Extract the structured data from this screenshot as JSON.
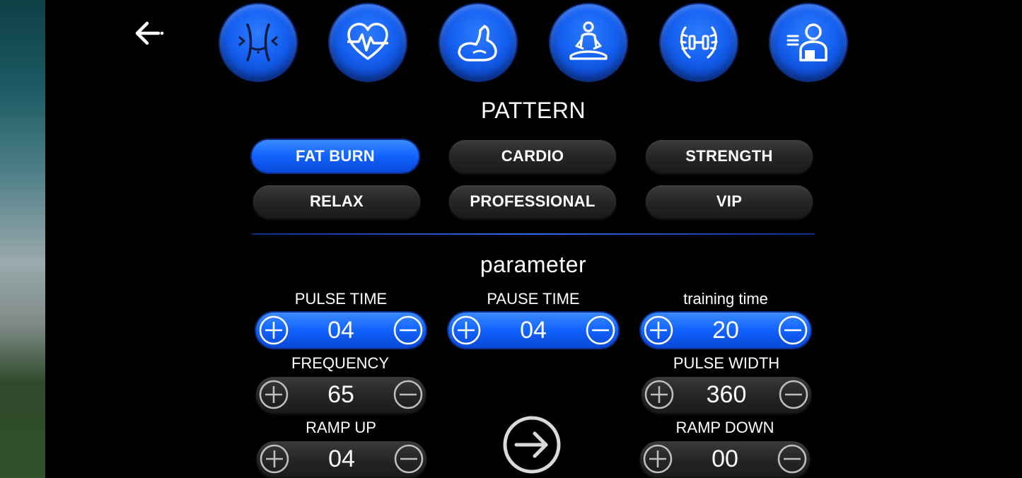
{
  "modes": [
    {
      "icon": "waist-slimming-icon"
    },
    {
      "icon": "heart-pulse-icon"
    },
    {
      "icon": "flexed-arm-icon"
    },
    {
      "icon": "meditation-icon"
    },
    {
      "icon": "dumbbell-laurel-icon"
    },
    {
      "icon": "user-profile-icon"
    }
  ],
  "pattern": {
    "title": "PATTERN",
    "options": [
      "FAT BURN",
      "CARDIO",
      "STRENGTH",
      "RELAX",
      "PROFESSIONAL",
      "VIP"
    ],
    "selected": "FAT BURN"
  },
  "parameter": {
    "title": "parameter",
    "pulse_time": {
      "label": "PULSE TIME",
      "value": "04"
    },
    "pause_time": {
      "label": "PAUSE TIME",
      "value": "04"
    },
    "training_time": {
      "label": "training time",
      "value": "20"
    },
    "frequency": {
      "label": "FREQUENCY",
      "value": "65"
    },
    "pulse_width": {
      "label": "PULSE WIDTH",
      "value": "360"
    },
    "ramp_up": {
      "label": "RAMP UP",
      "value": "04"
    },
    "ramp_down": {
      "label": "RAMP DOWN",
      "value": "00"
    }
  },
  "colors": {
    "accent": "#1062ff",
    "inactive": "#262626",
    "background": "#000000"
  }
}
